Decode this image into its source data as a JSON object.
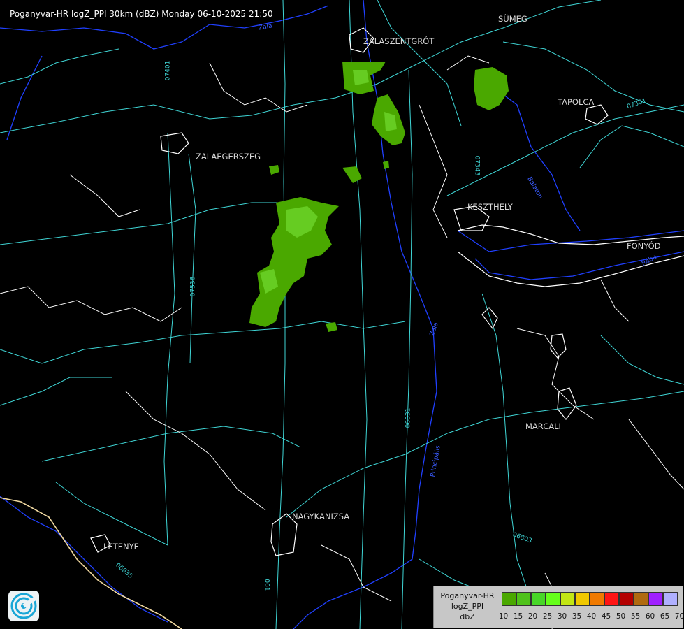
{
  "title": "Poganyvar-HR logZ_PPI 30km (dBZ) Monday 06-10-2025 21:50",
  "cities": [
    {
      "id": "sumeg",
      "name": "SÜMEG"
    },
    {
      "id": "zalaszentgrot",
      "name": "ZALASZENTGRÓT"
    },
    {
      "id": "tapolca",
      "name": "TAPOLCA"
    },
    {
      "id": "zalaegerszeg",
      "name": "ZALAEGERSZEG"
    },
    {
      "id": "keszthely",
      "name": "KESZTHELY"
    },
    {
      "id": "fonyod",
      "name": "FONYÓD"
    },
    {
      "id": "marcali",
      "name": "MARCALI"
    },
    {
      "id": "nagykanizsa",
      "name": "NAGYKANIZSA"
    },
    {
      "id": "letenye",
      "name": "LETENYE"
    }
  ],
  "road_labels": [
    "07401",
    "07343",
    "07301",
    "07536",
    "06831",
    "06803",
    "06635",
    "061",
    "Zala",
    "Balaton",
    "Zala",
    "Principális",
    "Rába"
  ],
  "legend": {
    "line1": "Poganyvar-HR",
    "line2": "logZ_PPI",
    "line3": "dbZ",
    "colors": [
      "#4aa800",
      "#4fc21a",
      "#48d628",
      "#66ff1a",
      "#c2e614",
      "#f0c800",
      "#f07a00",
      "#ff1414",
      "#b40000",
      "#b06a10",
      "#a020ff",
      "#b0b0ff"
    ],
    "ticks": [
      "10",
      "15",
      "20",
      "25",
      "30",
      "35",
      "40",
      "45",
      "50",
      "55",
      "60",
      "65",
      "70"
    ]
  },
  "colors": {
    "background": "#000000",
    "roads": "#3fd6d6",
    "borders": "#ffffff",
    "rivers": "#2040ff",
    "echo_low": "#4aa800",
    "echo_mid": "#66cc22"
  }
}
